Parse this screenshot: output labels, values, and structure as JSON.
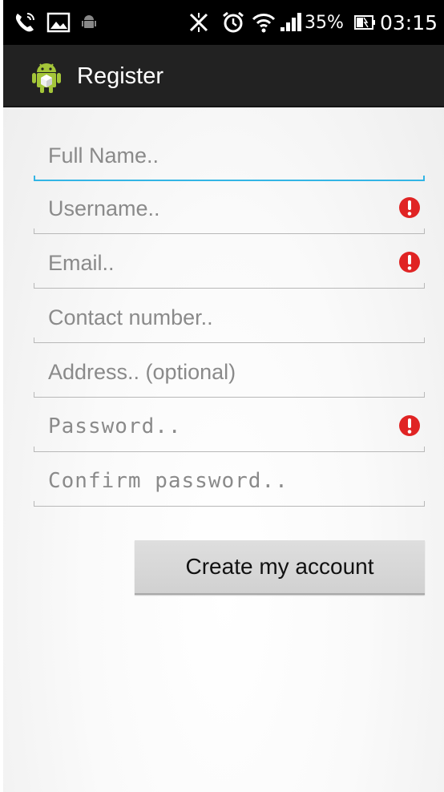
{
  "status_bar": {
    "battery": "35%",
    "time": "03:15",
    "icons": [
      "call-icon",
      "gallery-icon",
      "android-debug-icon",
      "mute-icon",
      "alarm-icon",
      "wifi-icon",
      "signal-icon",
      "battery-icon"
    ]
  },
  "action_bar": {
    "title": "Register",
    "app_icon": "android-app-icon"
  },
  "form": {
    "full_name": {
      "placeholder": "Full Name..",
      "value": "",
      "focused": true,
      "error": false
    },
    "username": {
      "placeholder": "Username..",
      "value": "",
      "error": true
    },
    "email": {
      "placeholder": "Email..",
      "value": "",
      "error": true
    },
    "contact": {
      "placeholder": "Contact number..",
      "value": "",
      "error": false
    },
    "address": {
      "placeholder": "Address.. (optional)",
      "value": "",
      "error": false
    },
    "password": {
      "placeholder": "Password..",
      "value": "",
      "error": true
    },
    "confirm_password": {
      "placeholder": "Confirm password..",
      "value": "",
      "error": false
    },
    "submit_label": "Create my account"
  },
  "colors": {
    "status_bar_bg": "#000000",
    "action_bar_bg": "#222222",
    "focus_accent": "#33b5e5",
    "error_red": "#e02424",
    "android_green": "#a4c639"
  }
}
